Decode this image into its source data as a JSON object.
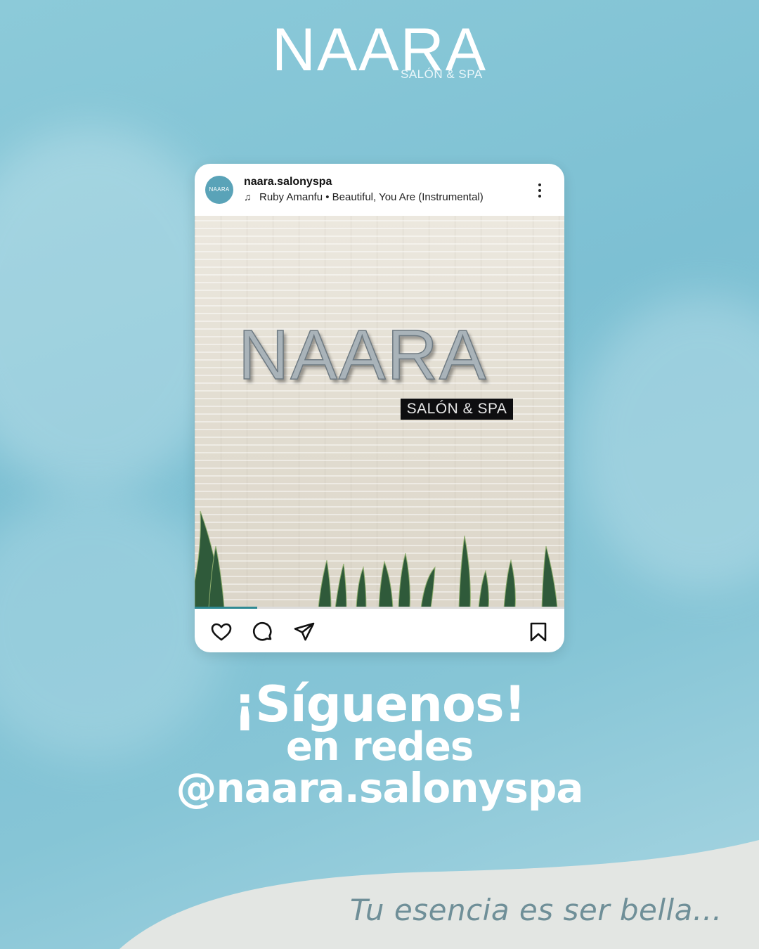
{
  "colors": {
    "background": "#7dc0d3",
    "card": "#ffffff",
    "accent": "#2f8a94",
    "tagline": "#6f8f98",
    "bottom_wave": "#e3e6e3"
  },
  "brand": {
    "name": "NAARA",
    "subtitle": "SALÓN & SPA"
  },
  "post": {
    "avatar_text": "NAARA",
    "username": "naara.salonyspa",
    "music_icon": "music-note-icon",
    "music": "Ruby Amanfu • Beautiful, You Are (Instrumental)",
    "more_icon": "more-vertical-icon",
    "photo": {
      "sign_text": "NAARA",
      "plaque_text": "SALÓN & SPA"
    },
    "progress": 0.17,
    "actions": {
      "like_icon": "heart-icon",
      "comment_icon": "comment-icon",
      "share_icon": "send-icon",
      "save_icon": "bookmark-icon"
    }
  },
  "cta": {
    "main": "¡Síguenos!",
    "sub": "en redes",
    "handle": "@naara.salonyspa"
  },
  "tagline": "Tu esencia es ser bella..."
}
